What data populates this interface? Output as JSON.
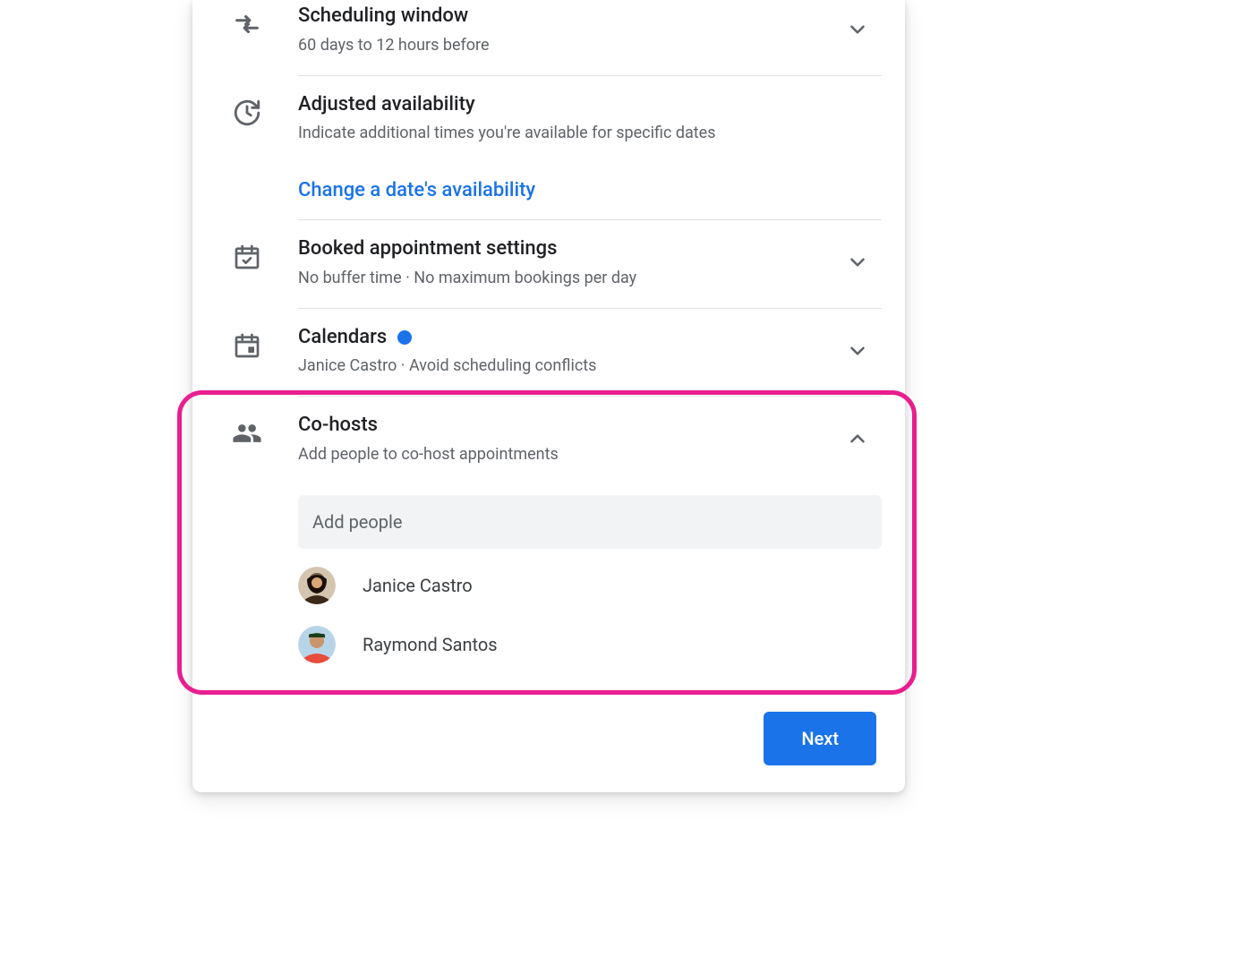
{
  "sections": {
    "scheduling_window": {
      "title": "Scheduling window",
      "subtitle": "60 days to 12 hours before"
    },
    "adjusted_availability": {
      "title": "Adjusted availability",
      "subtitle": "Indicate additional times you're available for specific dates",
      "link": "Change a date's availability"
    },
    "booked_settings": {
      "title": "Booked appointment settings",
      "subtitle": "No buffer time · No maximum bookings per day"
    },
    "calendars": {
      "title": "Calendars",
      "subtitle": "Janice Castro · Avoid scheduling conflicts"
    },
    "cohosts": {
      "title": "Co-hosts",
      "subtitle": "Add people to co-host appointments",
      "input_placeholder": "Add people",
      "people": [
        {
          "name": "Janice Castro"
        },
        {
          "name": "Raymond Santos"
        }
      ]
    }
  },
  "footer": {
    "next_label": "Next"
  }
}
